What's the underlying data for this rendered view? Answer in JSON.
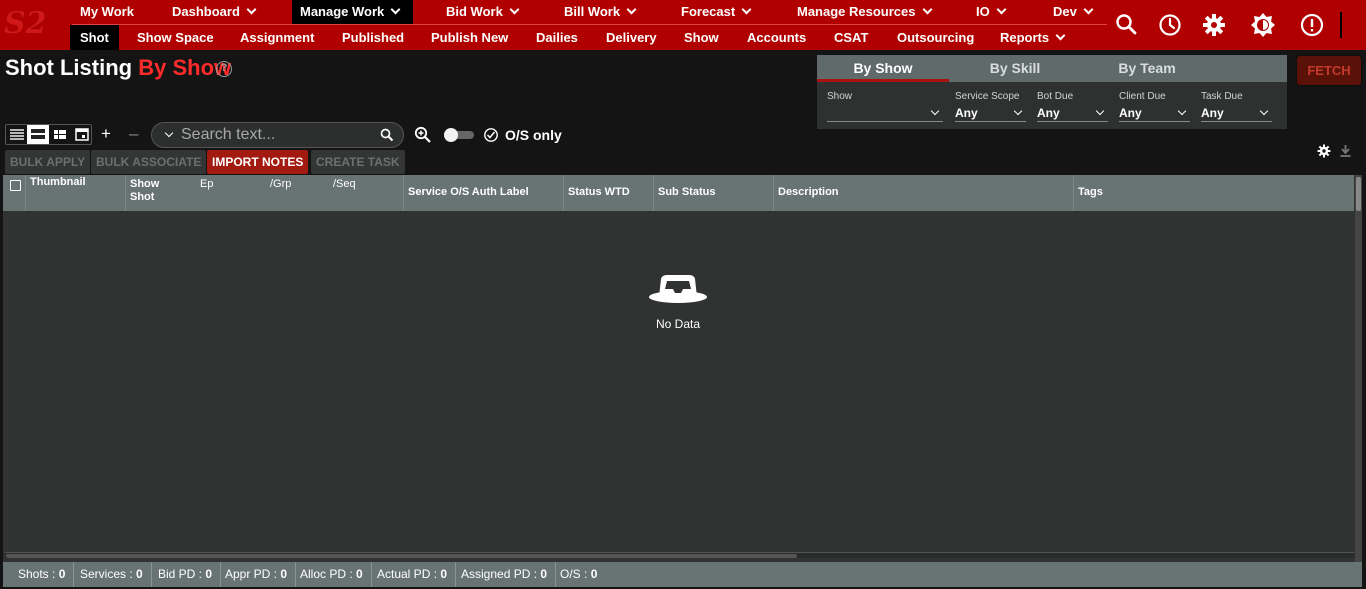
{
  "app": {
    "logo_text": "S2"
  },
  "nav": {
    "main": [
      {
        "label": "My Work"
      },
      {
        "label": "Dashboard"
      },
      {
        "label": "Manage Work"
      },
      {
        "label": "Bid Work"
      },
      {
        "label": "Bill Work"
      },
      {
        "label": "Forecast"
      },
      {
        "label": "Manage Resources"
      },
      {
        "label": "IO"
      },
      {
        "label": "Dev"
      }
    ],
    "sub": [
      {
        "label": "Shot"
      },
      {
        "label": "Show Space"
      },
      {
        "label": "Assignment"
      },
      {
        "label": "Published"
      },
      {
        "label": "Publish New"
      },
      {
        "label": "Dailies"
      },
      {
        "label": "Delivery"
      },
      {
        "label": "Show"
      },
      {
        "label": "Accounts"
      },
      {
        "label": "CSAT"
      },
      {
        "label": "Outsourcing"
      },
      {
        "label": "Reports"
      }
    ],
    "icons": [
      "search-icon",
      "history-icon",
      "settings-icon",
      "theme-icon",
      "alert-icon"
    ]
  },
  "page": {
    "title": "Shot Listing",
    "title_accent": "By Show"
  },
  "filter": {
    "tabs": [
      {
        "label": "By Show"
      },
      {
        "label": "By Skill"
      },
      {
        "label": "By Team"
      }
    ],
    "fields": [
      {
        "label": "Show",
        "value": ""
      },
      {
        "label": "Service Scope",
        "value": "Any"
      },
      {
        "label": "Bot Due",
        "value": "Any"
      },
      {
        "label": "Client Due",
        "value": "Any"
      },
      {
        "label": "Task Due",
        "value": "Any"
      }
    ],
    "fetch_label": "FETCH"
  },
  "toolbar": {
    "plus": "+",
    "minus": "–",
    "search_placeholder": "Search text...",
    "os_only_label": "O/S only",
    "actions": [
      {
        "label": "BULK APPLY"
      },
      {
        "label": "BULK ASSOCIATE"
      },
      {
        "label": "IMPORT NOTES"
      },
      {
        "label": "CREATE TASK"
      }
    ]
  },
  "grid": {
    "columns": [
      {
        "label": "Thumbnail"
      },
      {
        "label": "Show"
      },
      {
        "label": "Shot"
      },
      {
        "label": "Ep"
      },
      {
        "label": "/Grp"
      },
      {
        "label": "/Seq"
      },
      {
        "label": "Service O/S Auth Label"
      },
      {
        "label": "Status WTD"
      },
      {
        "label": "Sub Status"
      },
      {
        "label": "Description"
      },
      {
        "label": "Tags"
      }
    ],
    "empty_text": "No Data"
  },
  "status": [
    {
      "label": "Shots :",
      "value": "0"
    },
    {
      "label": "Services :",
      "value": "0"
    },
    {
      "label": "Bid PD :",
      "value": "0"
    },
    {
      "label": "Appr PD :",
      "value": "0"
    },
    {
      "label": "Alloc PD :",
      "value": "0"
    },
    {
      "label": "Actual PD :",
      "value": "0"
    },
    {
      "label": "Assigned PD :",
      "value": "0"
    },
    {
      "label": "O/S :",
      "value": "0"
    }
  ],
  "colors": {
    "brand_red": "#b00000",
    "accent_red": "#ff2b2b",
    "grid_header": "#687373"
  }
}
